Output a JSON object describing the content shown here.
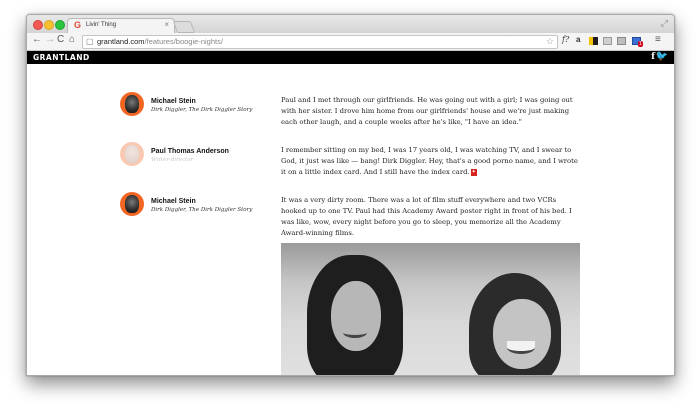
{
  "browser": {
    "tab_title": "Livin' Thing",
    "tab_favicon": "G",
    "tab_close": "×",
    "url_host": "grantland.com",
    "url_path": "/features/boogie-nights/",
    "extensions": {
      "fq": "f?",
      "amazon": "a",
      "badge": "1"
    },
    "icons": {
      "back": "←",
      "forward": "→",
      "reload": "C",
      "home": "⌂",
      "star": "☆",
      "menu": "≡",
      "page": "▢",
      "fullscreen": "⤢"
    },
    "colors": {
      "close": "#f25a53",
      "minimize": "#f6c02e",
      "maximize": "#2bc43e"
    }
  },
  "site": {
    "logo": "GRANTLAND",
    "social": {
      "facebook": "f",
      "twitter": "🐦"
    }
  },
  "entries": [
    {
      "name": "Michael Stein",
      "role": "Dirk Diggler, The Dirk Diggler Story",
      "quote": "Paul and I met through our girlfriends. He was going out with a girl; I was going out with her sister. I drove him home from our girlfriends' house and we're just making each other laugh, and a couple weeks after he's like, \"I have an idea.\"",
      "marker": ""
    },
    {
      "name": "Paul Thomas Anderson",
      "role": "Writer-director",
      "quote": "I remember sitting on my bed, I was 17 years old, I was watching TV, and I swear to God, it just was like — bang! Dirk Diggler. Hey, that's a good porno name, and I wrote it on a little index card. And I still have the index card.",
      "marker": "✦"
    },
    {
      "name": "Michael Stein",
      "role": "Dirk Diggler, The Dirk Diggler Story",
      "quote": "It was a very dirty room. There was a lot of film stuff everywhere and two VCRs hooked up to one TV. Paul had this Academy Award poster right in front of his bed. I was like, wow, every night before you go to sleep, you memorize all the Academy Award-winning films.",
      "marker": ""
    }
  ]
}
